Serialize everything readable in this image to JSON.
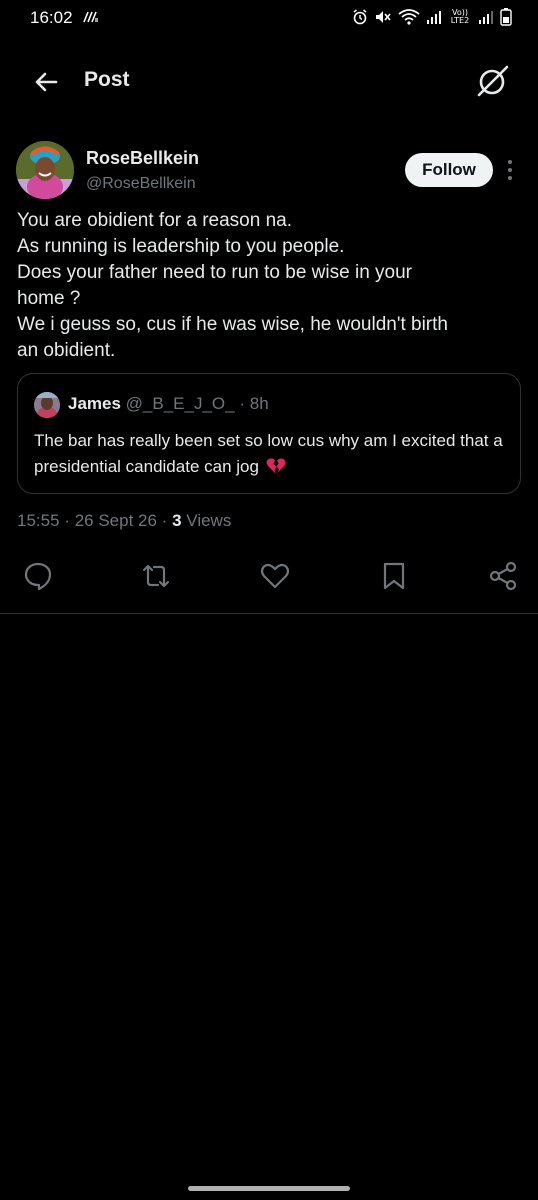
{
  "status_bar": {
    "time": "16:02",
    "lte_label": "Vo)) LTE2",
    "icons": [
      "network-activity-icon",
      "alarm-icon",
      "mute-icon",
      "wifi-icon",
      "signal-icon",
      "signal-icon-2",
      "battery-icon"
    ]
  },
  "header": {
    "title": "Post",
    "back_icon": "arrow-left-icon",
    "grok_icon": "grok-icon"
  },
  "post": {
    "author_name": "RoseBellkein",
    "author_handle": "@RoseBellkein",
    "follow_label": "Follow",
    "text_lines": [
      "You are obidient for a reason na.",
      "As running is leadership to you people.",
      "Does your father need to run to be wise in your",
      "home ?",
      "We i geuss so, cus if he was wise, he wouldn't birth",
      "an obidient."
    ],
    "quote": {
      "name": "James",
      "handle": "@_B_E_J_O_",
      "separator": "·",
      "time": "8h",
      "text": "The bar has really been set so low cus why am I excited that a presidential candidate can jog",
      "emoji": "broken-heart"
    },
    "timestamp": "15:55",
    "date": "26 Sept 26",
    "meta_sep": "·",
    "views_count": "3",
    "views_label": "Views"
  },
  "actions": [
    "reply-icon",
    "repost-icon",
    "like-icon",
    "bookmark-icon",
    "share-icon"
  ],
  "colors": {
    "background": "#000000",
    "text": "#e7e9ea",
    "muted": "#71767b",
    "border": "#2f3336",
    "follow_bg": "#eff3f4",
    "emoji": "#e0245e"
  }
}
